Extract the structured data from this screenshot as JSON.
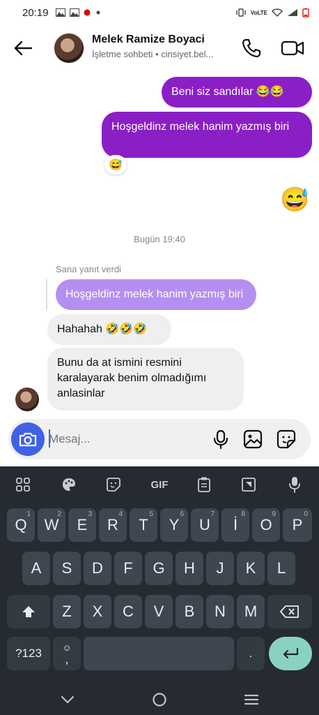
{
  "status_bar": {
    "time": "20:19",
    "left_icons": [
      "image-icon",
      "image-icon",
      "vodafone-icon",
      "dot-icon"
    ],
    "right_icons": [
      "vibrate-icon",
      "volte-icon",
      "wifi-icon",
      "signal-icon",
      "battery-icon"
    ],
    "volte_label": "VoLTE"
  },
  "header": {
    "contact_name": "Melek Ramize Boyaci",
    "subtitle": "İşletme sohbeti • cinsiyet.bel..."
  },
  "messages": {
    "out1": "Beni siz sandılar 😂😂",
    "out2": "Hoşgeldinz melek hanim yazmış biri",
    "out2_reaction": "😅",
    "big_emoji": "😅",
    "date_separator": "Bugün 19:40",
    "reply_label": "Sana yanıt verdi",
    "reply_preview": "Hoşgeldinz melek hanim yazmış biri",
    "in1": "Hahahah 🤣🤣🤣",
    "in2": "Bunu da at ismini resmini karalayarak benim olmadığımı anlasinlar"
  },
  "composer": {
    "placeholder": "Mesaj..."
  },
  "keyboard": {
    "toolbar_gif": "GIF",
    "row1": [
      {
        "key": "Q",
        "hint": "1"
      },
      {
        "key": "W",
        "hint": "2"
      },
      {
        "key": "E",
        "hint": "3"
      },
      {
        "key": "R",
        "hint": "4"
      },
      {
        "key": "T",
        "hint": "5"
      },
      {
        "key": "Y",
        "hint": "6"
      },
      {
        "key": "U",
        "hint": "7"
      },
      {
        "key": "İ",
        "hint": "8"
      },
      {
        "key": "O",
        "hint": "9"
      },
      {
        "key": "P",
        "hint": "0"
      }
    ],
    "row2": [
      "A",
      "S",
      "D",
      "F",
      "G",
      "H",
      "J",
      "K",
      "L"
    ],
    "row3": [
      "Z",
      "X",
      "C",
      "V",
      "B",
      "N",
      "M"
    ],
    "numbers_key": "?123",
    "emoji_comma_top": "☺",
    "emoji_comma_bottom": ",",
    "period_key": "."
  },
  "colors": {
    "outgoing_bubble": "#8b1fc6",
    "reply_preview": "#b58ff0",
    "camera_button": "#3f62e6",
    "enter_key": "#8ad1c4"
  }
}
